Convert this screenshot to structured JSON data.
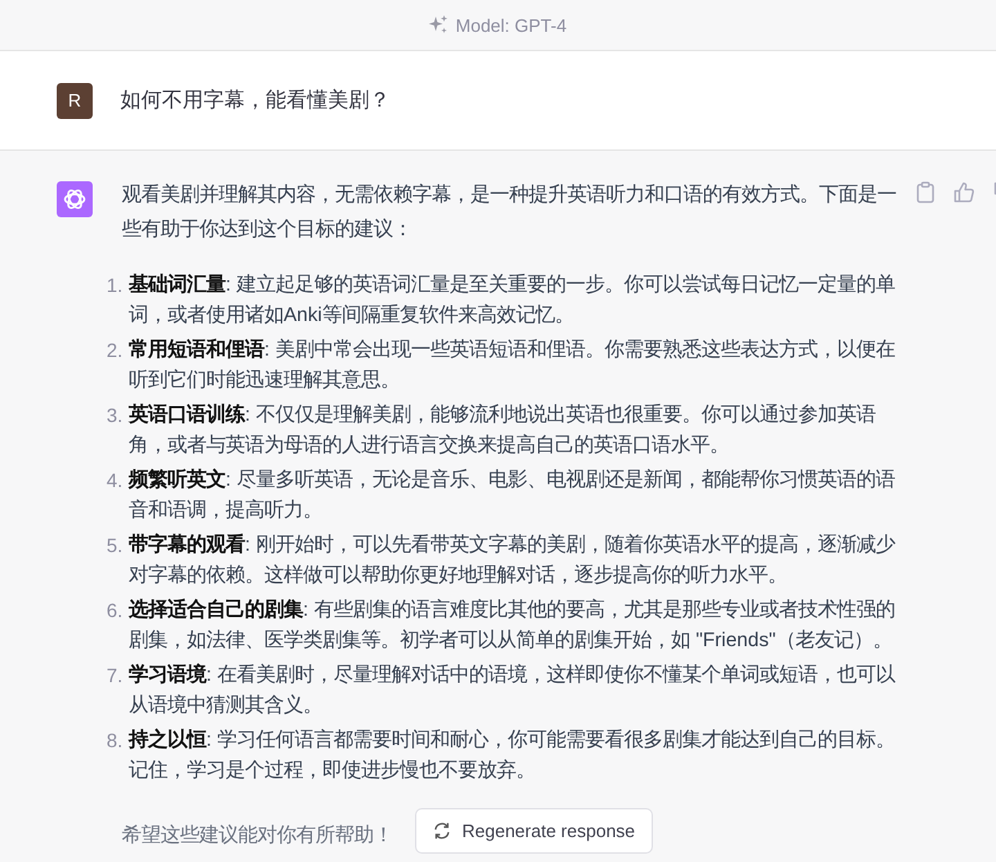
{
  "header": {
    "model_label": "Model: GPT-4"
  },
  "user_message": {
    "avatar_letter": "R",
    "text": "如何不用字幕，能看懂美剧？"
  },
  "assistant_message": {
    "intro": "观看美剧并理解其内容，无需依赖字幕，是一种提升英语听力和口语的有效方式。下面是一些有助于你达到这个目标的建议：",
    "items": [
      {
        "number": "1.",
        "text": "**基础词汇量**: 建立起足够的英语词汇量是至关重要的一步。你可以尝试每日记忆一定量的单词，或者使用诸如Anki等间隔重复软件来高效记忆。"
      },
      {
        "number": "2.",
        "text": "**常用短语和俚语**: 美剧中常会出现一些英语短语和俚语。你需要熟悉这些表达方式，以便在听到它们时能迅速理解其意思。"
      },
      {
        "number": "3.",
        "text": "**英语口语训练**: 不仅仅是理解美剧，能够流利地说出英语也很重要。你可以通过参加英语角，或者与英语为母语的人进行语言交换来提高自己的英语口语水平。"
      },
      {
        "number": "4.",
        "text": "**频繁听英文**: 尽量多听英语，无论是音乐、电影、电视剧还是新闻，都能帮你习惯英语的语音和语调，提高听力。"
      },
      {
        "number": "5.",
        "text": "**带字幕的观看**: 刚开始时，可以先看带英文字幕的美剧，随着你英语水平的提高，逐渐减少对字幕的依赖。这样做可以帮助你更好地理解对话，逐步提高你的听力水平。"
      },
      {
        "number": "6.",
        "text": "**选择适合自己的剧集**: 有些剧集的语言难度比其他的要高，尤其是那些专业或者技术性强的剧集，如法律、医学类剧集等。初学者可以从简单的剧集开始，如 \"Friends\"（老友记）。"
      },
      {
        "number": "7.",
        "text": "**学习语境**: 在看美剧时，尽量理解对话中的语境，这样即使你不懂某个单词或短语，也可以从语境中猜测其含义。"
      },
      {
        "number": "8.",
        "text": "**持之以恒**: 学习任何语言都需要时间和耐心，你可能需要看很多剧集才能达到自己的目标。记住，学习是个过程，即使进步慢也不要放弃。"
      }
    ],
    "closing": "希望这些建议能对你有所帮助！"
  },
  "regenerate_button": {
    "label": "Regenerate response"
  }
}
